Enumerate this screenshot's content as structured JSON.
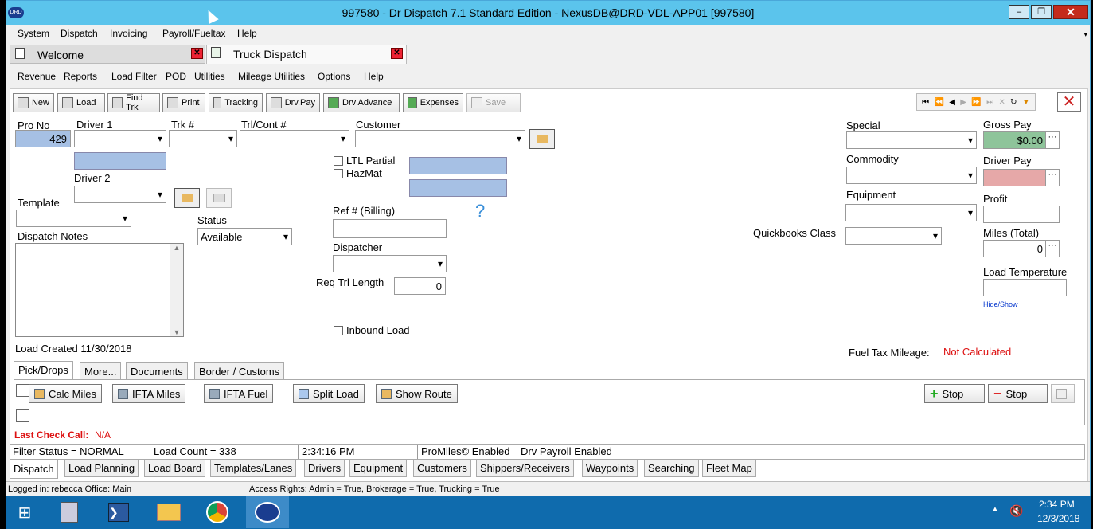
{
  "window": {
    "title": "997580 - Dr Dispatch 7.1 Standard Edition - NexusDB@DRD-VDL-APP01 [997580]",
    "app_icon": "DRD"
  },
  "menu": [
    "System",
    "Dispatch",
    "Invoicing",
    "Payroll/Fueltax",
    "Help"
  ],
  "doc_tabs": [
    {
      "label": "Welcome"
    },
    {
      "label": "Truck Dispatch"
    }
  ],
  "submenu": [
    "Revenue",
    "Reports",
    "Load Filter",
    "POD",
    "Utilities",
    "Mileage Utilities",
    "Options",
    "Help"
  ],
  "toolbar": {
    "new": "New",
    "load": "Load",
    "find": "Find Trk",
    "print": "Print",
    "tracking": "Tracking",
    "drvpay": "Drv.Pay",
    "drvadv": "Drv Advance",
    "expenses": "Expenses",
    "save": "Save"
  },
  "form": {
    "pro_no_label": "Pro No",
    "pro_no": "429",
    "driver1_label": "Driver 1",
    "driver2_label": "Driver 2",
    "trk_label": "Trk #",
    "trl_label": "Trl/Cont #",
    "customer_label": "Customer",
    "template_label": "Template",
    "status_label": "Status",
    "status_value": "Available",
    "dispatch_notes_label": "Dispatch Notes",
    "ltl_label": "LTL Partial",
    "hazmat_label": "HazMat",
    "ref_label": "Ref # (Billing)",
    "question": "?",
    "dispatcher_label": "Dispatcher",
    "req_trl_label": "Req Trl Length",
    "req_trl_value": "0",
    "inbound_label": "Inbound Load",
    "special_label": "Special",
    "commodity_label": "Commodity",
    "equipment_label": "Equipment",
    "qb_label": "Quickbooks Class",
    "gross_pay_label": "Gross Pay",
    "gross_pay": "$0.00",
    "driver_pay_label": "Driver Pay",
    "profit_label": "Profit",
    "miles_label": "Miles (Total)",
    "miles": "0",
    "load_temp_label": "Load Temperature",
    "hide_show": "Hide/Show",
    "load_created": "Load Created 11/30/2018",
    "fuel_tax_label": "Fuel Tax Mileage:",
    "fuel_tax_value": "Not Calculated"
  },
  "bottom_tabs": [
    "Pick/Drops",
    "More...",
    "Documents",
    "Border / Customs"
  ],
  "pick_buttons": {
    "calc": "Calc Miles",
    "ifta_miles": "IFTA Miles",
    "ifta_fuel": "IFTA Fuel",
    "split": "Split Load",
    "route": "Show Route",
    "add_stop": "Stop",
    "del_stop": "Stop"
  },
  "last_check": {
    "label": "Last Check Call:",
    "value": "N/A"
  },
  "status": [
    "Filter Status = NORMAL",
    "Load Count = 338",
    "2:34:16 PM",
    "ProMiles© Enabled",
    "Drv Payroll Enabled"
  ],
  "view_tabs": [
    "Dispatch",
    "Load Planning",
    "Load Board",
    "Templates/Lanes",
    "Drivers",
    "Equipment",
    "Customers",
    "Shippers/Receivers",
    "Waypoints",
    "Searching",
    "Fleet Map"
  ],
  "statusbar": {
    "left": "Logged in: rebecca  Office: Main",
    "right": "Access Rights: Admin = True, Brokerage = True, Trucking = True"
  },
  "taskbar": {
    "time": "2:34 PM",
    "date": "12/3/2018"
  }
}
